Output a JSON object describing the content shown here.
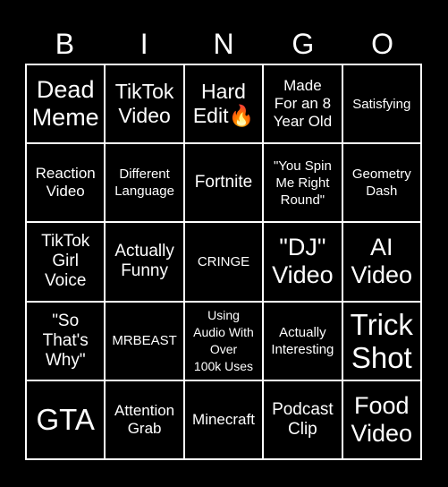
{
  "header": {
    "letters": [
      "B",
      "I",
      "N",
      "G",
      "O"
    ]
  },
  "board": {
    "rows": [
      [
        {
          "text": "Dead\nMeme",
          "size": "fs-lg"
        },
        {
          "text": "TikTok\nVideo",
          "size": "fs-ml"
        },
        {
          "text": "Hard\nEdit🔥",
          "size": "fs-ml"
        },
        {
          "text": "Made\nFor an 8\nYear Old",
          "size": "fs-sm"
        },
        {
          "text": "Satisfying",
          "size": "fs-xs"
        }
      ],
      [
        {
          "text": "Reaction\nVideo",
          "size": "fs-sm"
        },
        {
          "text": "Different\nLanguage",
          "size": "fs-xs"
        },
        {
          "text": "Fortnite",
          "size": "fs-md"
        },
        {
          "text": "\"You Spin\nMe Right\nRound\"",
          "size": "fs-xs"
        },
        {
          "text": "Geometry\nDash",
          "size": "fs-xs"
        }
      ],
      [
        {
          "text": "TikTok\nGirl\nVoice",
          "size": "fs-md"
        },
        {
          "text": "Actually\nFunny",
          "size": "fs-md"
        },
        {
          "text": "CRINGE",
          "size": "fs-xs"
        },
        {
          "text": "\"DJ\"\nVideo",
          "size": "fs-lg"
        },
        {
          "text": "AI\nVideo",
          "size": "fs-lg"
        }
      ],
      [
        {
          "text": "\"So\nThat's\nWhy\"",
          "size": "fs-md"
        },
        {
          "text": "MRBEAST",
          "size": "fs-xs"
        },
        {
          "text": "Using\nAudio With\nOver\n100k Uses",
          "size": "fs-xxs"
        },
        {
          "text": "Actually\nInteresting",
          "size": "fs-xs"
        },
        {
          "text": "Trick\nShot",
          "size": "fs-xl"
        }
      ],
      [
        {
          "text": "GTA",
          "size": "fs-xl"
        },
        {
          "text": "Attention\nGrab",
          "size": "fs-sm"
        },
        {
          "text": "Minecraft",
          "size": "fs-sm"
        },
        {
          "text": "Podcast\nClip",
          "size": "fs-md"
        },
        {
          "text": "Food\nVideo",
          "size": "fs-lg"
        }
      ]
    ]
  },
  "colors": {
    "background": "#000000",
    "foreground": "#ffffff"
  }
}
